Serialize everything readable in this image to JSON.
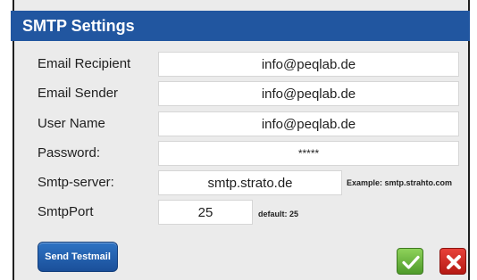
{
  "dialog": {
    "title": "SMTP Settings"
  },
  "fields": {
    "email_recipient": {
      "label": "Email Recipient",
      "value": "info@peqlab.de"
    },
    "email_sender": {
      "label": "Email Sender",
      "value": "info@peqlab.de"
    },
    "user_name": {
      "label": "User Name",
      "value": "info@peqlab.de"
    },
    "password": {
      "label": "Password:",
      "value": "*****"
    },
    "smtp_server": {
      "label": "Smtp-server:",
      "value": "smtp.strato.de",
      "hint": "Example: smtp.strahto.com"
    },
    "smtp_port": {
      "label": "SmtpPort",
      "value": "25",
      "hint": "default: 25"
    }
  },
  "buttons": {
    "send_testmail": "Send Testmail",
    "ok_icon": "check-icon",
    "cancel_icon": "close-icon"
  },
  "colors": {
    "titlebar": "#2156a0",
    "ok": "#5aa832",
    "cancel": "#cc2a22"
  }
}
